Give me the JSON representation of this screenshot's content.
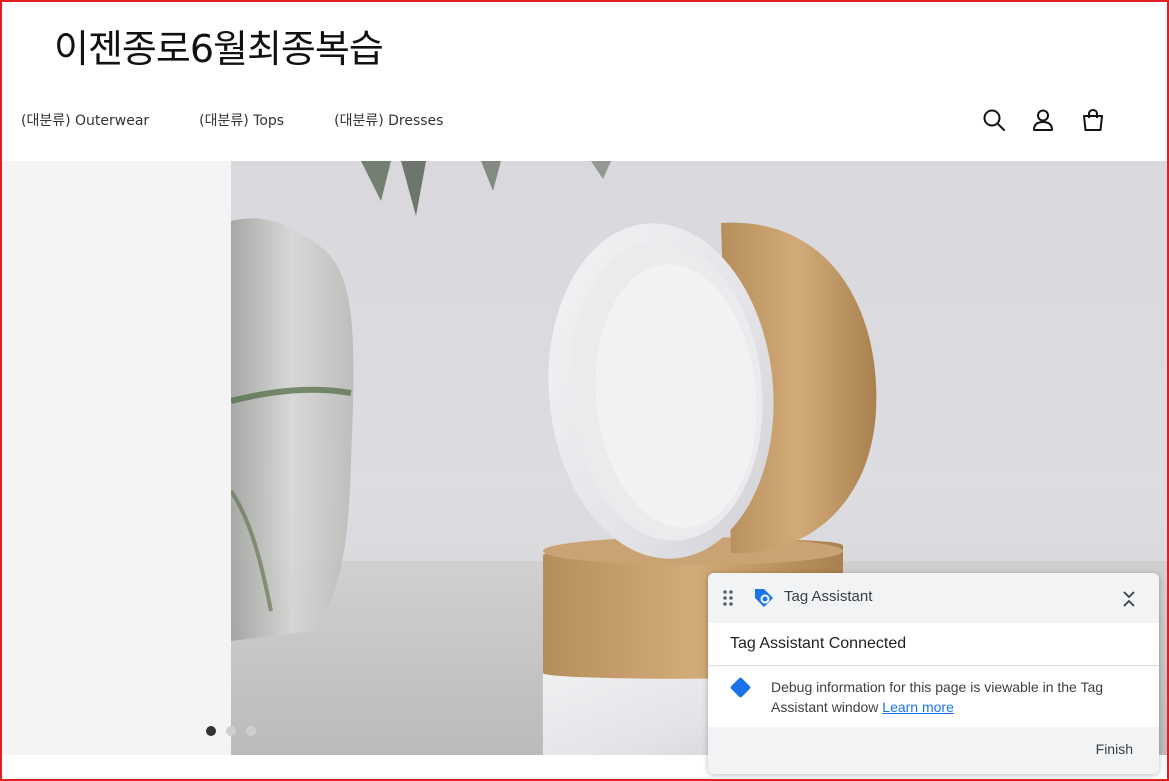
{
  "site": {
    "title": "이젠종로6월최종복습"
  },
  "nav": {
    "items": [
      {
        "label": "(대분류) Outerwear"
      },
      {
        "label": "(대분류) Tops"
      },
      {
        "label": "(대분류) Dresses"
      }
    ]
  },
  "header_icons": [
    "search-icon",
    "user-icon",
    "shopping-bag-icon"
  ],
  "hero": {
    "slide_count": 3,
    "active_slide": 1
  },
  "tag_assistant": {
    "title": "Tag Assistant",
    "status": "Tag Assistant Connected",
    "message": "Debug information for this page is viewable in the Tag Assistant window",
    "link_label": "Learn more",
    "finish_label": "Finish"
  },
  "colors": {
    "accent": "#1a73e8",
    "frame": "#e02020",
    "panel_bg": "#f1f3f4"
  }
}
